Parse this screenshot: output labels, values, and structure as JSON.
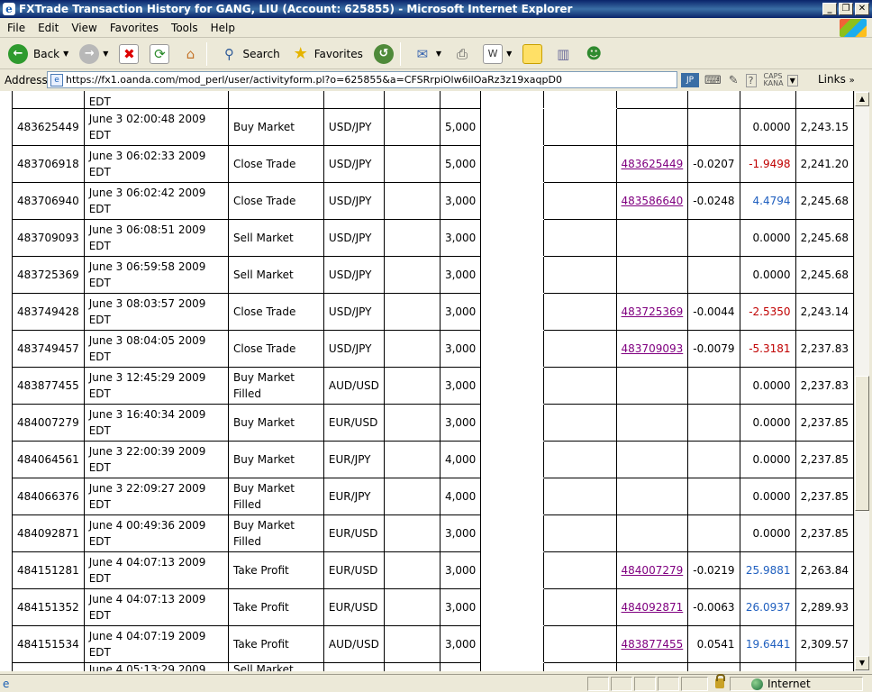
{
  "window": {
    "title": "FXTrade Transaction History for GANG, LIU (Account: 625855) - Microsoft Internet Explorer"
  },
  "menu": [
    "File",
    "Edit",
    "View",
    "Favorites",
    "Tools",
    "Help"
  ],
  "toolbar": {
    "back": "Back",
    "search": "Search",
    "favorites": "Favorites"
  },
  "address": {
    "label": "Address",
    "url": "https://fx1.oanda.com/mod_perl/user/activityform.pl?o=625855&a=CFSRrpiOlw6ilOaRz3z19xaqpD0",
    "links": "Links",
    "ime_caps": "CAPS",
    "ime_kana": "KANA"
  },
  "table": {
    "top_partial": {
      "time_tail": "EDT"
    },
    "rows": [
      {
        "id": "483625449",
        "time": "June 3 02:00:48 2009 EDT",
        "type": "Buy Market",
        "pair": "USD/JPY",
        "units": "5,000",
        "ref": "",
        "rate": "",
        "pl": "0.0000",
        "pl_color": "black",
        "balance": "2,243.15"
      },
      {
        "id": "483706918",
        "time": "June 3 06:02:33 2009 EDT",
        "type": "Close Trade",
        "pair": "USD/JPY",
        "units": "5,000",
        "ref": "483625449",
        "rate": "-0.0207",
        "pl": "-1.9498",
        "pl_color": "#c00000",
        "balance": "2,241.20"
      },
      {
        "id": "483706940",
        "time": "June 3 06:02:42 2009 EDT",
        "type": "Close Trade",
        "pair": "USD/JPY",
        "units": "3,000",
        "ref": "483586640",
        "rate": "-0.0248",
        "pl": "4.4794",
        "pl_color": "#1f5fbf",
        "balance": "2,245.68"
      },
      {
        "id": "483709093",
        "time": "June 3 06:08:51 2009 EDT",
        "type": "Sell Market",
        "pair": "USD/JPY",
        "units": "3,000",
        "ref": "",
        "rate": "",
        "pl": "0.0000",
        "pl_color": "black",
        "balance": "2,245.68"
      },
      {
        "id": "483725369",
        "time": "June 3 06:59:58 2009 EDT",
        "type": "Sell Market",
        "pair": "USD/JPY",
        "units": "3,000",
        "ref": "",
        "rate": "",
        "pl": "0.0000",
        "pl_color": "black",
        "balance": "2,245.68"
      },
      {
        "id": "483749428",
        "time": "June 3 08:03:57 2009 EDT",
        "type": "Close Trade",
        "pair": "USD/JPY",
        "units": "3,000",
        "ref": "483725369",
        "rate": "-0.0044",
        "pl": "-2.5350",
        "pl_color": "#c00000",
        "balance": "2,243.14"
      },
      {
        "id": "483749457",
        "time": "June 3 08:04:05 2009 EDT",
        "type": "Close Trade",
        "pair": "USD/JPY",
        "units": "3,000",
        "ref": "483709093",
        "rate": "-0.0079",
        "pl": "-5.3181",
        "pl_color": "#c00000",
        "balance": "2,237.83"
      },
      {
        "id": "483877455",
        "time": "June 3 12:45:29 2009 EDT",
        "type": "Buy Market Filled",
        "pair": "AUD/USD",
        "units": "3,000",
        "ref": "",
        "rate": "",
        "pl": "0.0000",
        "pl_color": "black",
        "balance": "2,237.83"
      },
      {
        "id": "484007279",
        "time": "June 3 16:40:34 2009 EDT",
        "type": "Buy Market",
        "pair": "EUR/USD",
        "units": "3,000",
        "ref": "",
        "rate": "",
        "pl": "0.0000",
        "pl_color": "black",
        "balance": "2,237.85"
      },
      {
        "id": "484064561",
        "time": "June 3 22:00:39 2009 EDT",
        "type": "Buy Market",
        "pair": "EUR/JPY",
        "units": "4,000",
        "ref": "",
        "rate": "",
        "pl": "0.0000",
        "pl_color": "black",
        "balance": "2,237.85"
      },
      {
        "id": "484066376",
        "time": "June 3 22:09:27 2009 EDT",
        "type": "Buy Market Filled",
        "pair": "EUR/JPY",
        "units": "4,000",
        "ref": "",
        "rate": "",
        "pl": "0.0000",
        "pl_color": "black",
        "balance": "2,237.85"
      },
      {
        "id": "484092871",
        "time": "June 4 00:49:36 2009 EDT",
        "type": "Buy Market Filled",
        "pair": "EUR/USD",
        "units": "3,000",
        "ref": "",
        "rate": "",
        "pl": "0.0000",
        "pl_color": "black",
        "balance": "2,237.85"
      },
      {
        "id": "484151281",
        "time": "June 4 04:07:13 2009 EDT",
        "type": "Take Profit",
        "pair": "EUR/USD",
        "units": "3,000",
        "ref": "484007279",
        "rate": "-0.0219",
        "pl": "25.9881",
        "pl_color": "#1f5fbf",
        "balance": "2,263.84"
      },
      {
        "id": "484151352",
        "time": "June 4 04:07:13 2009 EDT",
        "type": "Take Profit",
        "pair": "EUR/USD",
        "units": "3,000",
        "ref": "484092871",
        "rate": "-0.0063",
        "pl": "26.0937",
        "pl_color": "#1f5fbf",
        "balance": "2,289.93"
      },
      {
        "id": "484151534",
        "time": "June 4 04:07:19 2009 EDT",
        "type": "Take Profit",
        "pair": "AUD/USD",
        "units": "3,000",
        "ref": "483877455",
        "rate": "0.0541",
        "pl": "19.6441",
        "pl_color": "#1f5fbf",
        "balance": "2,309.57"
      }
    ],
    "bottom_partial": {
      "time": "June 4 05:13:29 2009",
      "type": "Sell Market"
    }
  },
  "status": {
    "zone": "Internet"
  }
}
